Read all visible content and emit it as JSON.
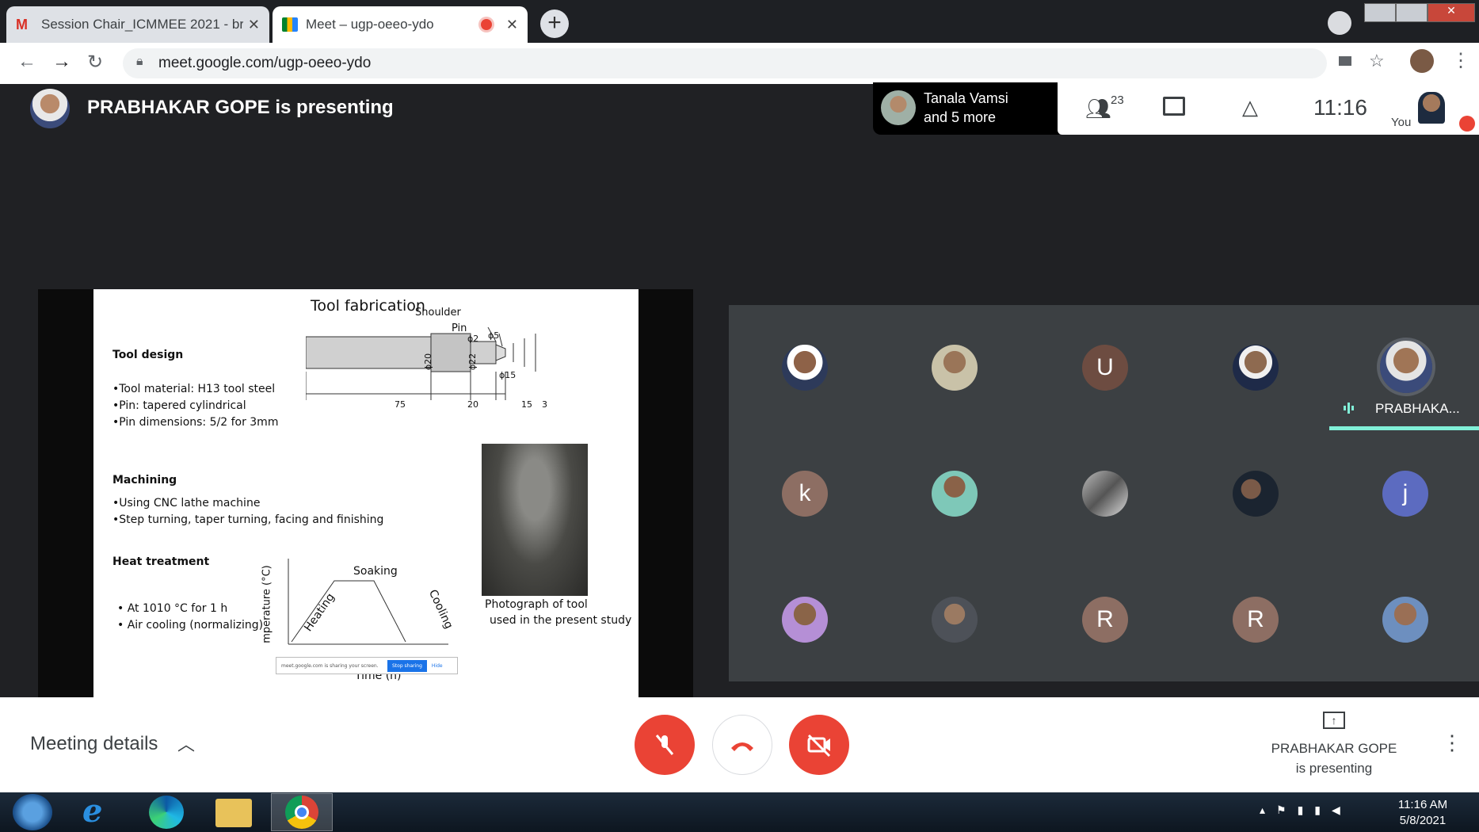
{
  "browser": {
    "tabs": [
      {
        "title": "Session Chair_ICMMEE 2021 - br",
        "icon": "gmail-icon"
      },
      {
        "title": "Meet – ugp-oeeo-ydo",
        "icon": "meet-icon"
      }
    ],
    "url": "meet.google.com/ugp-oeeo-ydo"
  },
  "meet": {
    "presenting_label": "PRABHAKAR GOPE is presenting",
    "speaker_chip": {
      "line1": "Tanala Vamsi",
      "line2": "and 5 more"
    },
    "participant_count": "23",
    "clock": "11:16",
    "you_label": "You",
    "active_speaker_name": "PRABHAKA...",
    "grid_letters": [
      "U",
      "k",
      "j",
      "R",
      "R"
    ],
    "meeting_details": "Meeting details",
    "presenting_status_line1": "PRABHAKAR GOPE",
    "presenting_status_line2": "is presenting"
  },
  "slide": {
    "title": "Tool fabrication",
    "tool_design_heading": "Tool design",
    "tool_design_items": [
      "•Tool material: H13 tool steel",
      "•Pin: tapered cylindrical",
      "•Pin dimensions: 5/2 for 3mm"
    ],
    "machining_heading": "Machining",
    "machining_items": [
      "•Using CNC lathe machine",
      "•Step turning, taper turning, facing and finishing"
    ],
    "heat_heading": "Heat treatment",
    "heat_items": [
      "• At 1010 °C for 1 h",
      "• Air cooling (normalizing)"
    ],
    "drawing_labels": {
      "shoulder": "Shoulder",
      "pin": "Pin",
      "d2": "ϕ2",
      "d5": "ϕ5",
      "d15": "ϕ15",
      "d20": "ϕ20",
      "d22": "ϕ22",
      "l75": "75",
      "l20": "20",
      "l15": "15",
      "l3": "3"
    },
    "graph_labels": {
      "soaking": "Soaking",
      "heating": "Heating",
      "cooling": "Cooling",
      "yaxis": "mperature (°C)",
      "xaxis": "Time (h)"
    },
    "photo_caption_1": "Photograph of tool",
    "photo_caption_2": "used in the present study",
    "share_bar": {
      "text": "meet.google.com is sharing your screen.",
      "stop": "Stop sharing",
      "hide": "Hide"
    }
  },
  "taskbar": {
    "time": "11:16 AM",
    "date": "5/8/2021"
  },
  "colors": {
    "red": "#ea4335",
    "meet_dark": "#202124",
    "teal": "#81f0d8"
  }
}
